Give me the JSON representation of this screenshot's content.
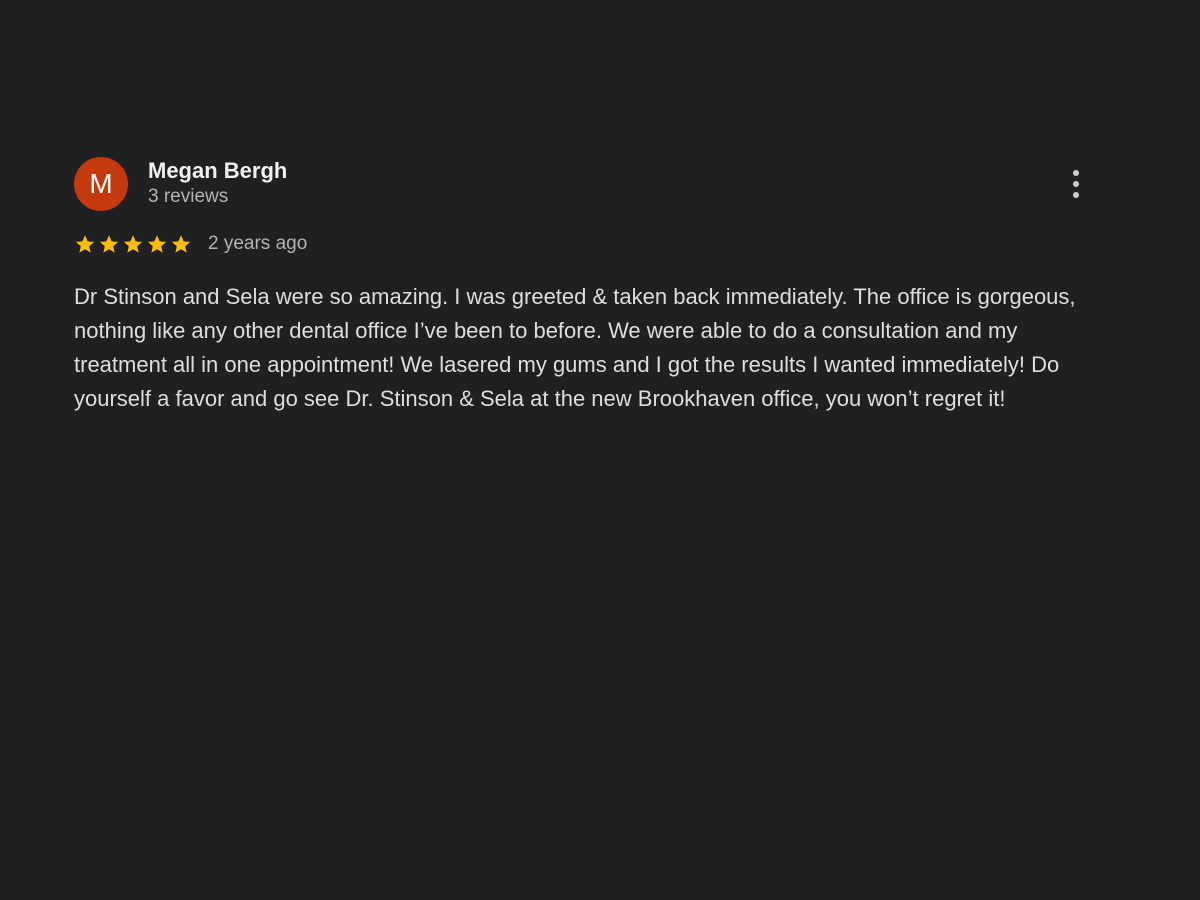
{
  "review": {
    "author": {
      "avatar_initial": "M",
      "avatar_color": "#c43a0e",
      "name": "Megan Bergh",
      "review_count": "3 reviews"
    },
    "rating": 5,
    "rating_max": 5,
    "star_color": "#fbbc04",
    "time_ago": "2 years ago",
    "text": "Dr Stinson and Sela were so amazing. I was greeted & taken back immediately. The office is gorgeous, nothing like any other dental office I’ve been to before. We were able to do a consultation and my treatment all in one appointment! We lasered my gums and I got the results I wanted immediately! Do yourself a favor and go see Dr. Stinson & Sela at the new Brookhaven office, you won’t regret it!",
    "menu_icon": "more-vert-icon"
  }
}
